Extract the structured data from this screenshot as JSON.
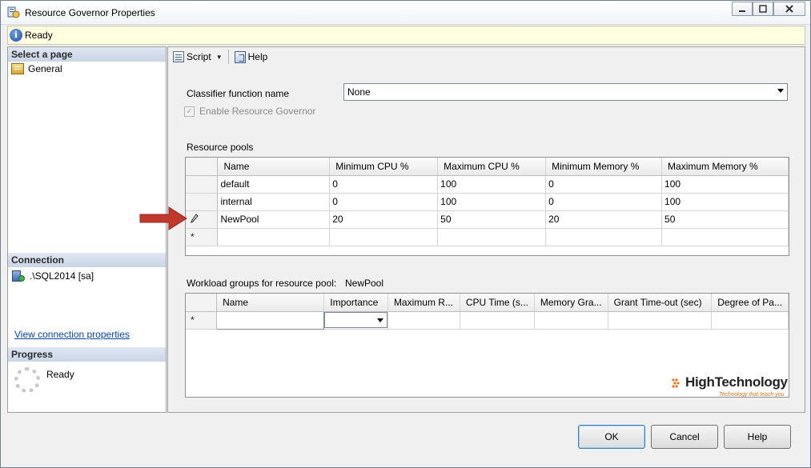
{
  "window": {
    "title": "Resource Governor Properties",
    "controls": [
      "minimize",
      "maximize",
      "close"
    ]
  },
  "status": {
    "text": "Ready"
  },
  "left_panel": {
    "select_page_header": "Select a page",
    "pages": [
      {
        "label": "General"
      }
    ],
    "connection_header": "Connection",
    "connection_server": ".\\SQL2014 [sa]",
    "view_connection_link": "View connection properties",
    "progress_header": "Progress",
    "progress_status": "Ready"
  },
  "toolbar": {
    "script_label": "Script",
    "help_label": "Help"
  },
  "form": {
    "classifier_label": "Classifier function name",
    "classifier_value": "None",
    "enable_label": "Enable Resource Governor",
    "enable_checked": true
  },
  "resource_pools": {
    "label": "Resource pools",
    "columns": [
      "Name",
      "Minimum CPU %",
      "Maximum CPU %",
      "Minimum Memory %",
      "Maximum Memory %"
    ],
    "rows": [
      {
        "marker": "",
        "cells": [
          "default",
          "0",
          "100",
          "0",
          "100"
        ]
      },
      {
        "marker": "pencil",
        "cells": [
          "internal",
          "0",
          "100",
          "0",
          "100"
        ]
      },
      {
        "marker": "pencil",
        "cells": [
          "NewPool",
          "20",
          "50",
          "20",
          "50"
        ]
      },
      {
        "marker": "*",
        "cells": [
          "",
          "",
          "",
          "",
          ""
        ]
      }
    ]
  },
  "workload_groups": {
    "label": "Workload groups for resource pool:",
    "pool_name": "NewPool",
    "columns": [
      "Name",
      "Importance",
      "Maximum R...",
      "CPU Time (s...",
      "Memory Gra...",
      "Grant Time-out (sec)",
      "Degree of Pa..."
    ],
    "rows": [
      {
        "marker": "*",
        "cells": [
          "",
          "",
          "",
          "",
          "",
          "",
          ""
        ]
      }
    ]
  },
  "watermark": {
    "brand": "HighTechnology",
    "tagline": "Technology that teach you",
    "accent": "#e8731a"
  },
  "buttons": {
    "ok": "OK",
    "cancel": "Cancel",
    "help": "Help"
  },
  "colors": {
    "status_bg": "#ffffe1",
    "section_header": "#c9d5e6",
    "link": "#0645ad",
    "arrow": "#c0392b"
  }
}
